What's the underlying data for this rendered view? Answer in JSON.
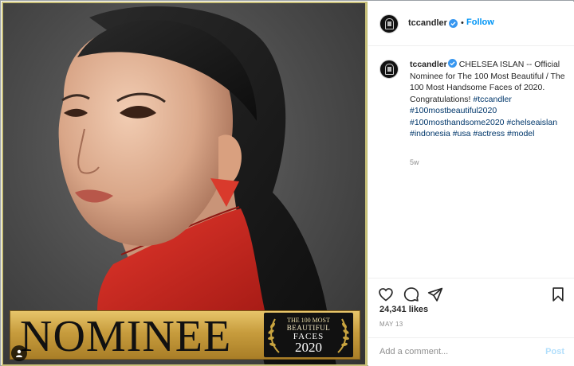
{
  "post": {
    "username": "tccandler",
    "follow_label": "Follow",
    "dot": "•",
    "caption": {
      "username": "tccandler",
      "text": "CHELSEA ISLAN -- Official Nominee for The 100 Most Beautiful / The 100 Most Handsome Faces of 2020. Congratulations!",
      "hashtags": [
        "#tccandler",
        "#100mostbeautiful2020",
        "#100mosthandsome2020",
        "#chelseaislan",
        "#indonesia",
        "#usa",
        "#actress",
        "#model"
      ]
    },
    "time_ago": "5w",
    "likes": "24,341 likes",
    "date": "MAY 13",
    "comment_placeholder": "Add a comment...",
    "post_label": "Post"
  },
  "image": {
    "banner_word": "NOMINEE",
    "badge": {
      "line1": "THE 100 MOST",
      "line2": "BEAUTIFUL",
      "line3": "FACES",
      "year": "2020"
    }
  },
  "icons": {
    "like": "heart-icon",
    "comment": "comment-icon",
    "share": "paper-plane-icon",
    "save": "bookmark-icon",
    "verified": "verified-badge-icon",
    "tagged": "person-tag-icon"
  },
  "colors": {
    "link": "#0095f6",
    "hashtag": "#00376b",
    "muted": "#8e8e8e",
    "banner_gold": "#c79c3d",
    "sweater_red": "#cf2a22"
  }
}
